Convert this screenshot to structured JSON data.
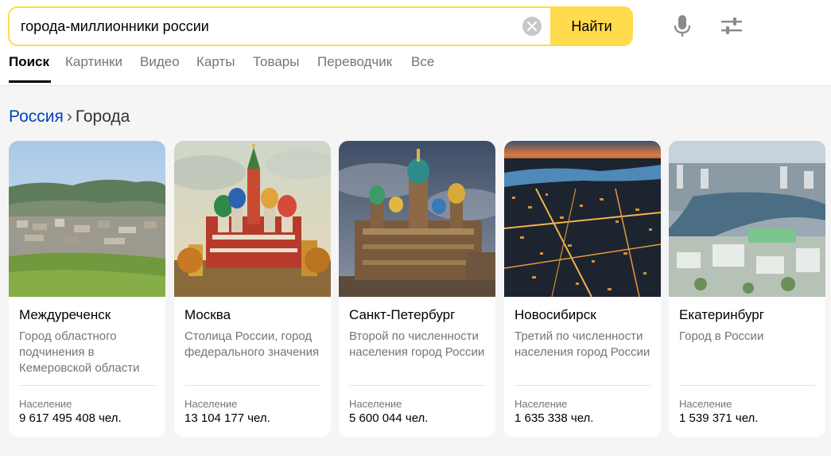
{
  "search": {
    "query": "города-миллионники россии",
    "button_label": "Найти"
  },
  "tabs": [
    {
      "label": "Поиск",
      "active": true
    },
    {
      "label": "Картинки"
    },
    {
      "label": "Видео"
    },
    {
      "label": "Карты"
    },
    {
      "label": "Товары"
    },
    {
      "label": "Переводчик"
    },
    {
      "label": "Все"
    }
  ],
  "breadcrumb": {
    "link": "Россия",
    "separator": "›",
    "current": "Города"
  },
  "cards": [
    {
      "title": "Междуреченск",
      "description": "Город областного подчинения в Кемеровской области",
      "population_label": "Население",
      "population": "9 617 495 408 чел."
    },
    {
      "title": "Москва",
      "description": "Столица России, город федерального значения",
      "population_label": "Население",
      "population": "13 104 177 чел."
    },
    {
      "title": "Санкт-Петербург",
      "description": "Второй по численности населения город России",
      "population_label": "Население",
      "population": "5 600 044 чел."
    },
    {
      "title": "Новосибирск",
      "description": "Третий по численности населения город России",
      "population_label": "Население",
      "population": "1 635 338 чел."
    },
    {
      "title": "Екатеринбург",
      "description": "Город в России",
      "population_label": "Население",
      "population": "1 539 371 чел."
    }
  ],
  "colors": {
    "accent": "#ffdb4d",
    "link": "#0044bb",
    "muted": "#757575"
  }
}
